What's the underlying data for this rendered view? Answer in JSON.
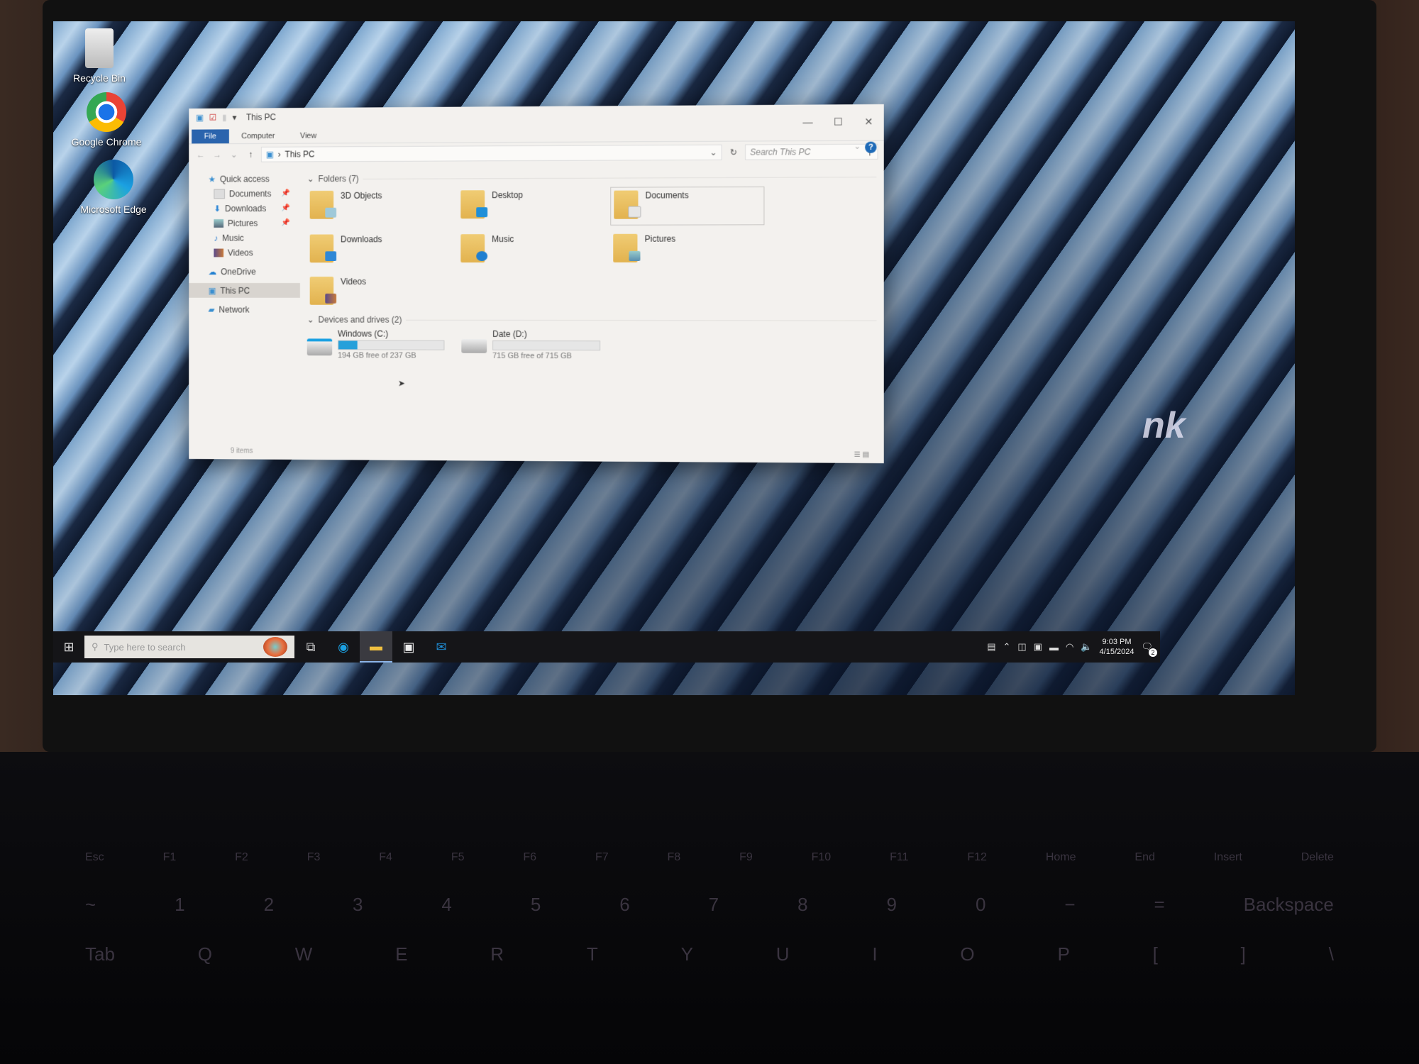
{
  "desktop": {
    "icons": [
      {
        "label": "Recycle Bin",
        "icon": "recycle-bin-icon"
      },
      {
        "label": "Google Chrome",
        "icon": "chrome-icon"
      },
      {
        "label": "Microsoft Edge",
        "icon": "edge-icon"
      }
    ],
    "wallpaper_brand_text": "nk"
  },
  "explorer": {
    "title": "This PC",
    "qat_dropdown": "▾",
    "ribbon_tabs": [
      {
        "label": "File",
        "active": true
      },
      {
        "label": "Computer"
      },
      {
        "label": "View"
      }
    ],
    "window_controls": {
      "minimize": "—",
      "maximize": "☐",
      "close": "✕"
    },
    "address": {
      "path": "This PC",
      "separator": "›"
    },
    "search": {
      "placeholder": "Search This PC"
    },
    "help": "?",
    "nav_pane": {
      "quick_access": "Quick access",
      "items": [
        {
          "label": "Documents",
          "pinned": true
        },
        {
          "label": "Downloads",
          "pinned": true
        },
        {
          "label": "Pictures",
          "pinned": true
        },
        {
          "label": "Music",
          "pinned": false
        },
        {
          "label": "Videos",
          "pinned": false
        }
      ],
      "onedrive": "OneDrive",
      "this_pc": "This PC",
      "network": "Network"
    },
    "folders_header": "Folders (7)",
    "folders": [
      {
        "label": "3D Objects",
        "badge_color": "#9fc9d9"
      },
      {
        "label": "Desktop",
        "badge_color": "#1f8fd8"
      },
      {
        "label": "Documents",
        "badge_color": "#e6e6e6",
        "selected": true
      },
      {
        "label": "Downloads",
        "badge_color": "#2f88d6"
      },
      {
        "label": "Music",
        "badge_color": "#1f7fd0"
      },
      {
        "label": "Pictures",
        "badge_color": "#5a8fb0"
      },
      {
        "label": "Videos",
        "badge_color": "#5a4a8a"
      }
    ],
    "drives_header": "Devices and drives (2)",
    "drives": [
      {
        "label": "Windows (C:)",
        "free": "194 GB free of 237 GB",
        "used_fraction": 0.18
      },
      {
        "label": "Date (D:)",
        "free": "715 GB free of 715 GB",
        "used_fraction": 0.0
      }
    ],
    "status": "9 items"
  },
  "taskbar": {
    "search_placeholder": "Type here to search",
    "apps": [
      "task-view",
      "edge",
      "file-explorer",
      "microsoft-store",
      "mail"
    ],
    "active_app": "file-explorer",
    "time": "9:03 PM",
    "date": "4/15/2024",
    "notification_count": "2"
  },
  "keyboard": {
    "row1": [
      "Esc",
      "F1",
      "F2",
      "F3",
      "F4",
      "F5",
      "F6",
      "F7",
      "F8",
      "F9",
      "F10",
      "F11",
      "F12",
      "Home",
      "End",
      "Insert",
      "Delete"
    ],
    "row2": [
      "~",
      "1",
      "2",
      "3",
      "4",
      "5",
      "6",
      "7",
      "8",
      "9",
      "0",
      "−",
      "=",
      "Backspace"
    ],
    "row3": [
      "Tab",
      "Q",
      "W",
      "E",
      "R",
      "T",
      "Y",
      "U",
      "I",
      "O",
      "P",
      "[",
      "]",
      "\\"
    ]
  }
}
